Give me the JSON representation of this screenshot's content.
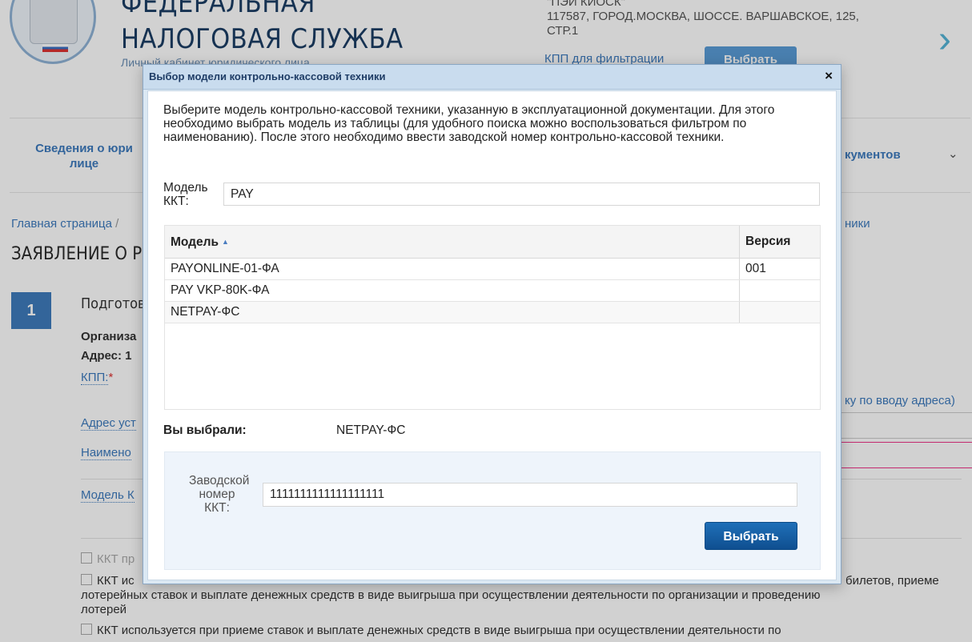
{
  "header": {
    "org_title_line1": "ФЕДЕРАЛЬНАЯ",
    "org_title_line2": "НАЛОГОВАЯ СЛУЖБА",
    "org_subtitle": "Личный кабинет юридического лица",
    "org_name_line1": "\"ПЭИ КИОСК\"",
    "org_name_line2": "117587, ГОРОД.МОСКВА, ШОССЕ. ВАРШАВСКОЕ, 125,",
    "org_name_line3": "СТР.1",
    "kpp_filter_link": "КПП для фильтрации",
    "select_button": "Выбрать"
  },
  "nav": {
    "item1": "Сведения о юри лице",
    "item_right": "кументов"
  },
  "breadcrumbs": {
    "home": "Главная страница",
    "separator": "/",
    "right": "ники"
  },
  "page": {
    "title": "ЗАЯВЛЕНИЕ О РЕ",
    "step_number": "1",
    "step_title": "Подготов",
    "org_label": "Организа",
    "address_label": "Адрес: 1",
    "kpp_label": "КПП:",
    "kpp_required": "*",
    "install_address_label": "Адрес уст",
    "name_label": "Наимено",
    "model_label": "Модель К",
    "address_hint_right": "ку по вводу адреса)",
    "check1": "ККТ пр",
    "check2_start": "ККТ ис",
    "check2_right": "билетов, приеме",
    "check2_line2": "лотерейных ставок и выплате денежных средств в виде выигрыша при осуществлении деятельности по организации и проведению",
    "check2_line3": "лотерей",
    "check3": "ККТ используется при приеме ставок и выплате денежных средств в виде выигрыша при осуществлении деятельности по"
  },
  "modal": {
    "title": "Выбор модели контрольно-кассовой техники",
    "close_glyph": "×",
    "intro": "Выберите модель контрольно-кассовой техники, указанную в эксплуатационной документации. Для этого необходимо выбрать модель из таблицы (для удобного поиска можно воспользоваться фильтром по наименованию). После этого необходимо ввести заводской номер контрольно-кассовой техники.",
    "model_filter_label": "Модель ККТ:",
    "model_filter_value": "PAY",
    "table": {
      "col_model": "Модель",
      "col_version": "Версия",
      "rows": [
        {
          "model": "PAYONLINE-01-ФА",
          "version": "001"
        },
        {
          "model": "PAY VKP-80K-ФА",
          "version": ""
        },
        {
          "model": "NETPAY-ФС",
          "version": ""
        }
      ]
    },
    "selected_label": "Вы выбрали:",
    "selected_value": "NETPAY-ФС",
    "serial_label": "Заводской номер ККТ:",
    "serial_value": "1111111111111111111",
    "select_button": "Выбрать"
  },
  "icons": {
    "next": "chevron-right-icon",
    "nav_chevron": "chevron-down-icon",
    "sort": "sort-ascending-icon"
  },
  "colors": {
    "link": "#3d7bbd",
    "primary_button": "#1466ad",
    "step_badge": "#3f7cbc"
  }
}
